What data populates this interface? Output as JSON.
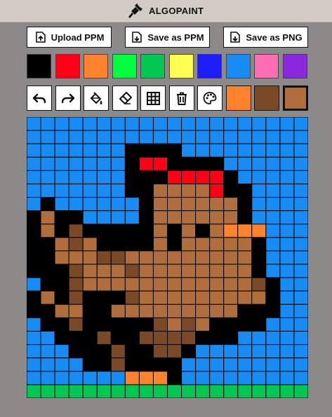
{
  "app": {
    "title": "ALGOPAINT"
  },
  "file_buttons": [
    {
      "name": "upload-ppm-button",
      "icon": "upload-file-icon",
      "label": "Upload PPM"
    },
    {
      "name": "save-ppm-button",
      "icon": "download-file-icon",
      "label": "Save as PPM"
    },
    {
      "name": "save-png-button",
      "icon": "download-file-icon",
      "label": "Save as PNG"
    }
  ],
  "palette": [
    "#000000",
    "#ff0015",
    "#ff822d",
    "#00ff41",
    "#00c853",
    "#ffff50",
    "#1e1efc",
    "#168cf4",
    "#ff6eb4",
    "#8c28dc"
  ],
  "tools": [
    "undo-icon",
    "redo-icon",
    "fill-bucket-icon",
    "eraser-icon",
    "grid-icon",
    "trash-icon",
    "palette-icon"
  ],
  "recent_colors": [
    "#ff822d",
    "#7a4a28",
    "#b06e3c"
  ],
  "selected_recent": 2,
  "canvas": {
    "cols": 20,
    "rows": 20,
    "colors": {
      "B": "#168cf4",
      "K": "#000000",
      "R": "#ff0015",
      "O": "#ff822d",
      "L": "#b06e3c",
      "D": "#7a4a28",
      "G": "#00c853"
    },
    "pixels": [
      "BBBBBBBBBBBBBBBBBBBB",
      "BBBBBBBBBBBBBBBBBBBB",
      "BBBBBBBKKKKBBBBBBBBB",
      "BBBBBBBKRRKKKKBBBBBB",
      "BBBBBBBKKKRRRRKBBBBB",
      "BBBBBBBKKLLLLRKKBBBB",
      "BKBBBBBBKLLLLLLKBBBB",
      "KLKKBBBBKLLLLLLKBBBB",
      "KLKDKKKKKLKLKLOOOBBB",
      "KKLDLKKKKLKLLLLLKBBB",
      "KKLLLDDLLLLLLLLLKBBB",
      "KKKDLLLDLLLLLLLLKBBB",
      "BKKDLLLLLLLLLLLLDKBB",
      "KLKDKKKDLLLLLLLLLKBB",
      "KKLLKKLLLLLLLLLKKKBB",
      "BKKDKKKKKDLDLKKKKBBB",
      "BBKKKDKKDDDDKKKBBBBB",
      "BBBKKKDKKDDKBBBBBBBB",
      "BBBBKKDKKKKBBBBBBBBB",
      "BBBBBBBOOOKBBBBBBBBB",
      "GGGGGGGGGGGGGGGGGGGG"
    ]
  }
}
